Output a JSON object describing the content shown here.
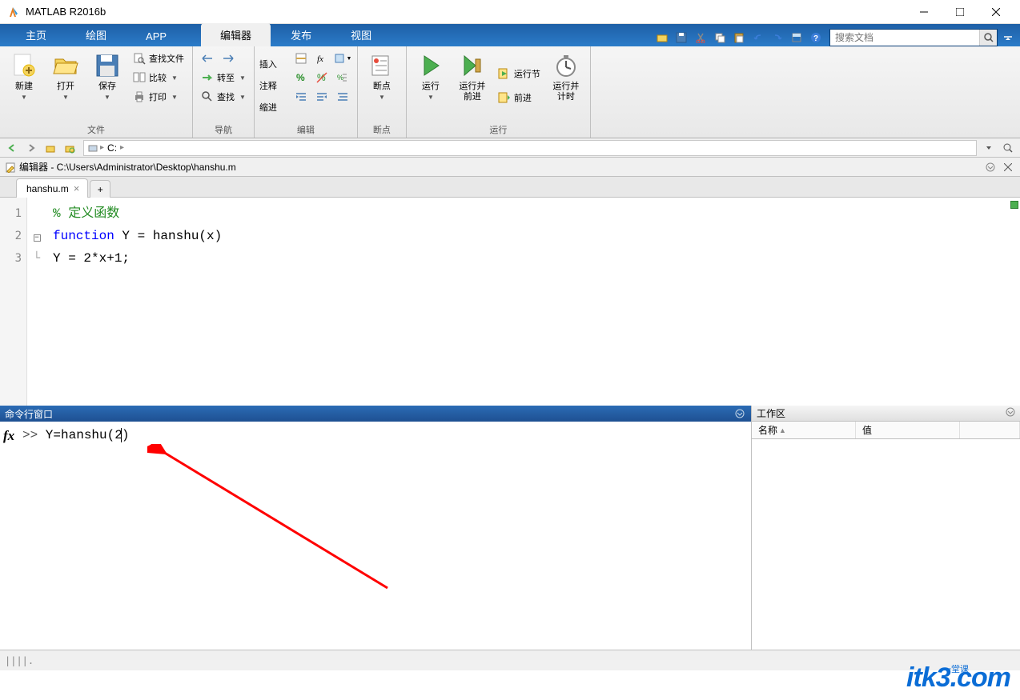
{
  "window": {
    "title": "MATLAB R2016b"
  },
  "main_tabs": [
    "主页",
    "绘图",
    "APP"
  ],
  "sub_tabs": {
    "items": [
      "编辑器",
      "发布",
      "视图"
    ],
    "active": "编辑器"
  },
  "search": {
    "placeholder": "搜索文档"
  },
  "ribbon": {
    "file": {
      "label": "文件",
      "new": "新建",
      "open": "打开",
      "save": "保存",
      "find_files": "查找文件",
      "compare": "比较",
      "print": "打印"
    },
    "nav": {
      "label": "导航",
      "goto": "转至",
      "find": "查找"
    },
    "edit": {
      "label": "编辑",
      "insert": "插入",
      "comment": "注释",
      "indent": "缩进"
    },
    "breakpoint": {
      "label": "断点",
      "btn": "断点"
    },
    "run": {
      "label": "运行",
      "run": "运行",
      "run_advance": "运行并\n前进",
      "run_section": "运行节",
      "advance": "前进",
      "run_time": "运行并\n计时"
    }
  },
  "path": {
    "drive": "C:"
  },
  "editor": {
    "title": "编辑器 - C:\\Users\\Administrator\\Desktop\\hanshu.m",
    "filename": "hanshu.m",
    "lines": {
      "n1": "1",
      "n2": "2",
      "n3": "3",
      "c1": "% 定义函数",
      "c2a": "function",
      "c2b": " Y = hanshu(x)",
      "c3": "Y = 2*x+1;"
    }
  },
  "command": {
    "title": "命令行窗口",
    "fx": "fx",
    "prompt": ">>",
    "input_a": " Y=hanshu(2",
    "input_b": ")"
  },
  "workspace": {
    "title": "工作区",
    "col_name": "名称",
    "col_value": "值"
  },
  "watermark": {
    "main": "itk3",
    "ext": ".com",
    "sub": "一堂课"
  }
}
